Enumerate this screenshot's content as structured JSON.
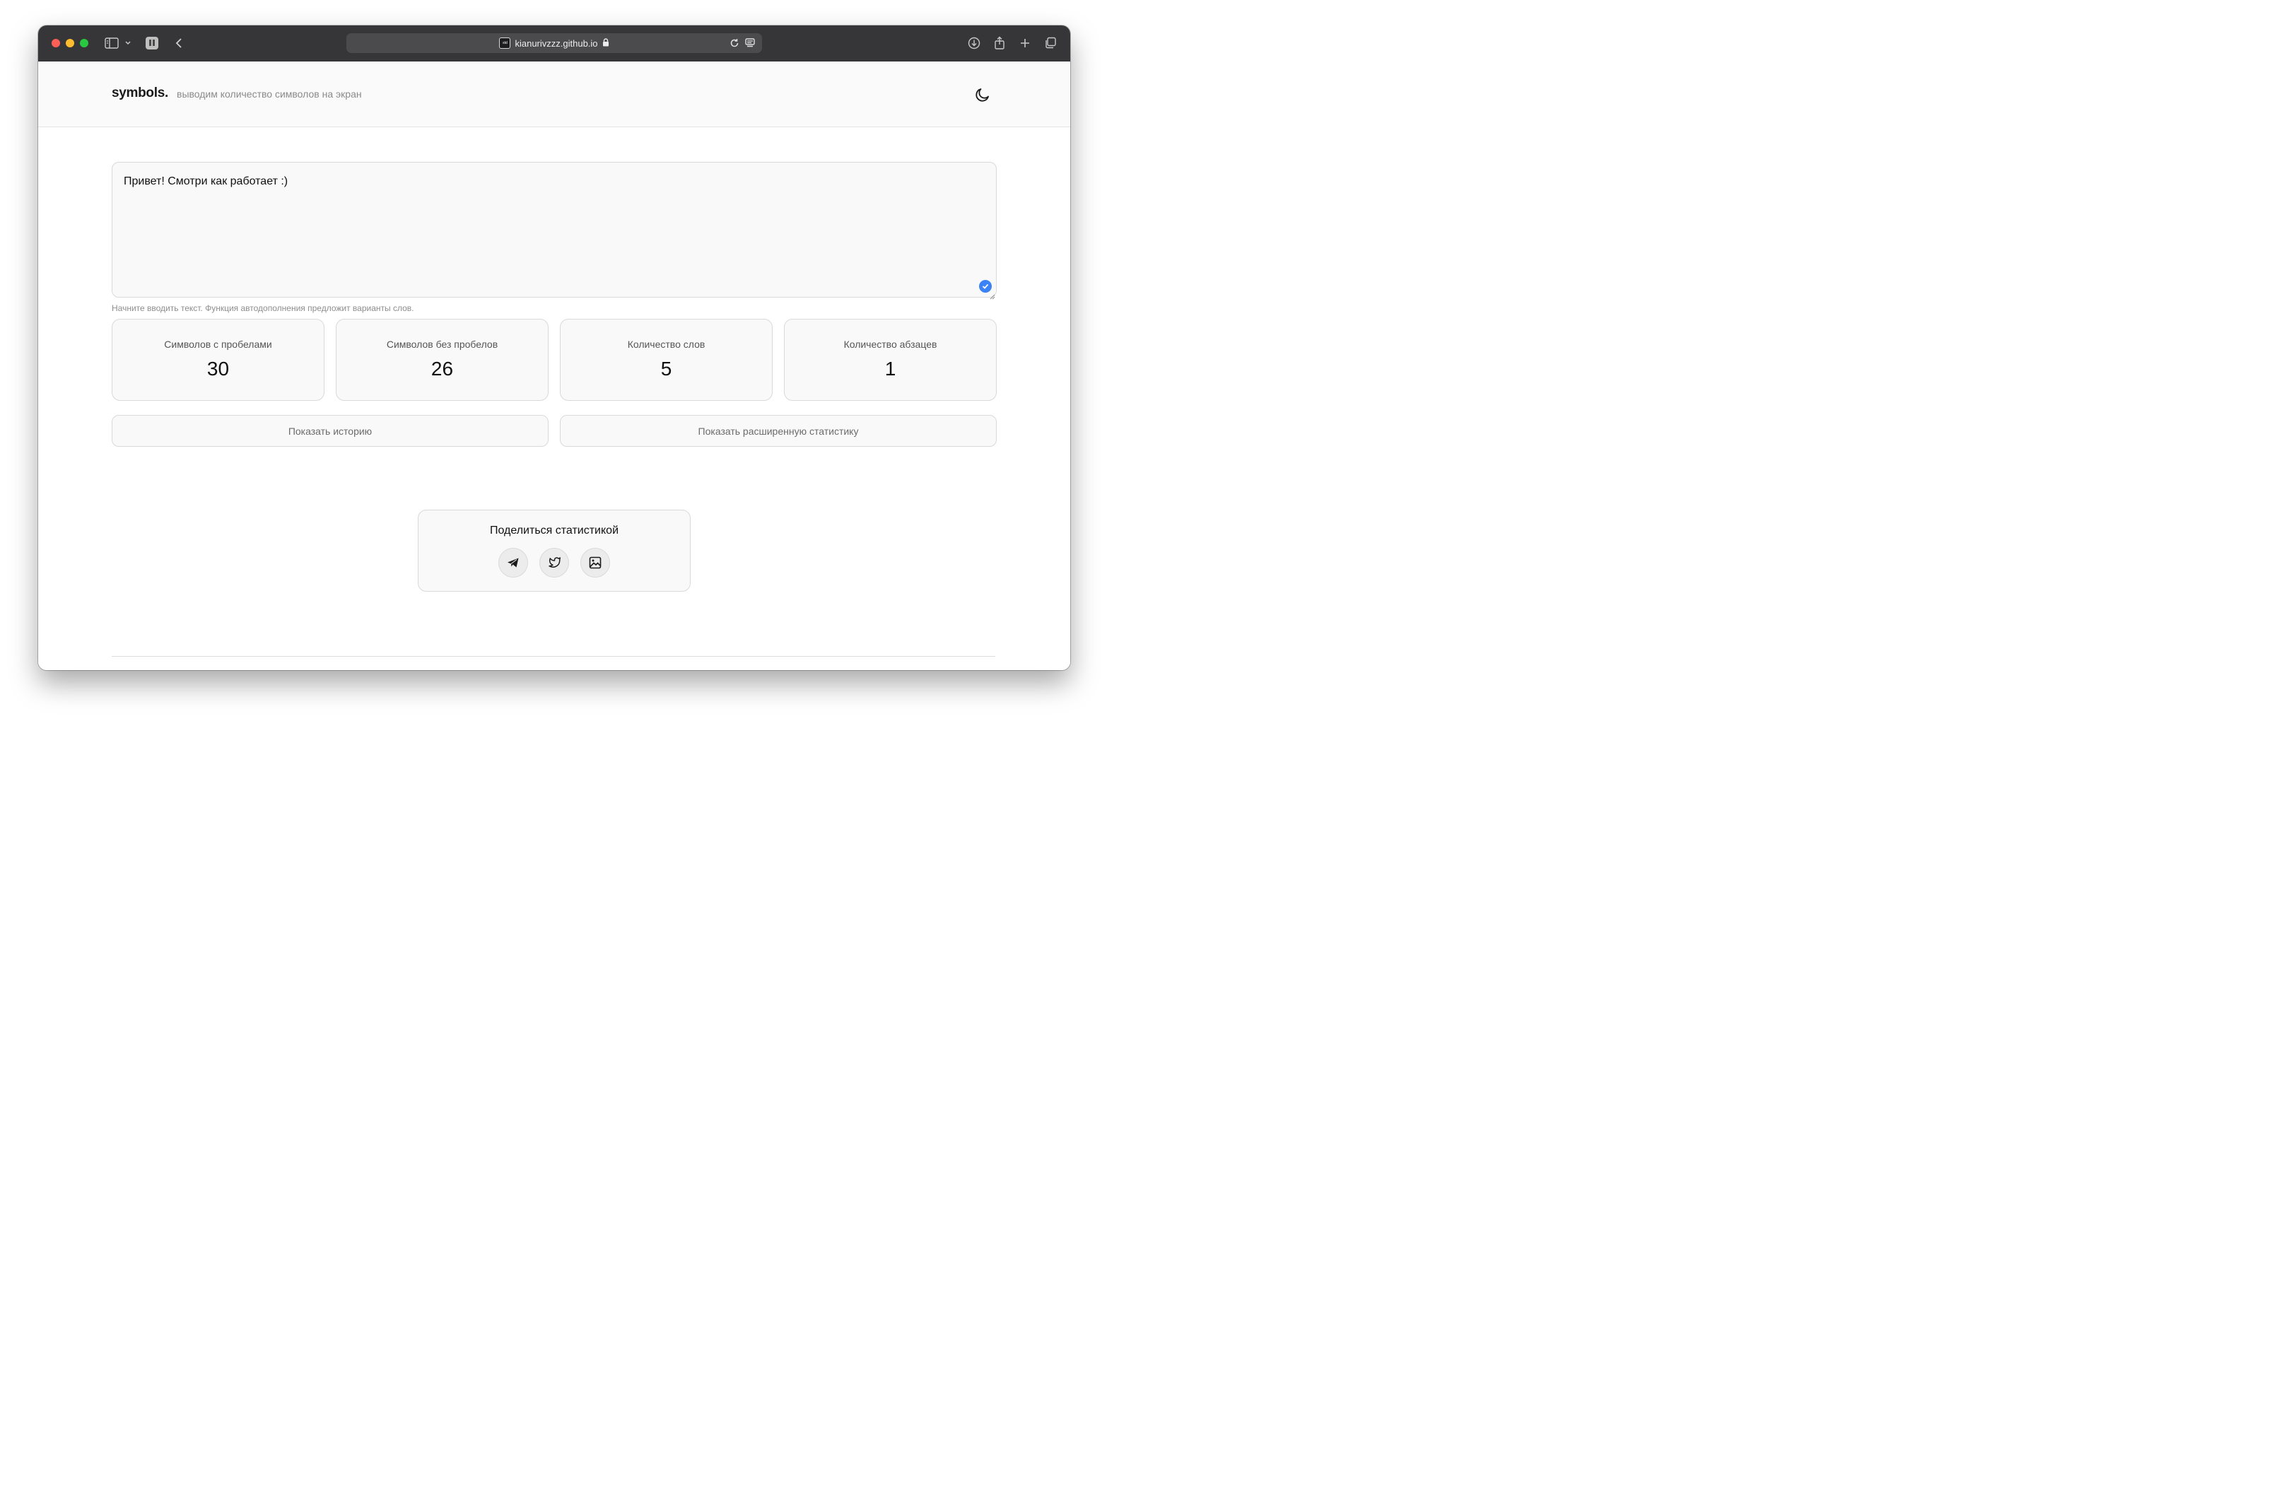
{
  "browser": {
    "url": "kianurivzzz.github.io",
    "icons": [
      "sidebar-icon",
      "chevron-down-icon",
      "extension-icon",
      "back-icon",
      "lock-icon",
      "reload-icon",
      "reader-icon",
      "download-icon",
      "share-icon",
      "plus-icon",
      "tabs-icon"
    ]
  },
  "header": {
    "logo": "symbols.",
    "tagline": "выводим количество символов на экран",
    "theme_icon": "moon-icon"
  },
  "editor": {
    "text": "Привет! Смотри как работает :)",
    "hint": "Начните вводить текст. Функция автодополнения предложит варианты слов."
  },
  "stats": [
    {
      "label": "Символов с пробелами",
      "value": "30"
    },
    {
      "label": "Символов без пробелов",
      "value": "26"
    },
    {
      "label": "Количество слов",
      "value": "5"
    },
    {
      "label": "Количество абзацев",
      "value": "1"
    }
  ],
  "actions": {
    "history": "Показать историю",
    "extended": "Показать расширенную статистику"
  },
  "share": {
    "title": "Поделиться статистикой",
    "buttons": [
      "telegram-icon",
      "twitter-icon",
      "image-icon"
    ]
  },
  "colors": {
    "accent": "#3b82f6",
    "titlebar": "#363638"
  }
}
